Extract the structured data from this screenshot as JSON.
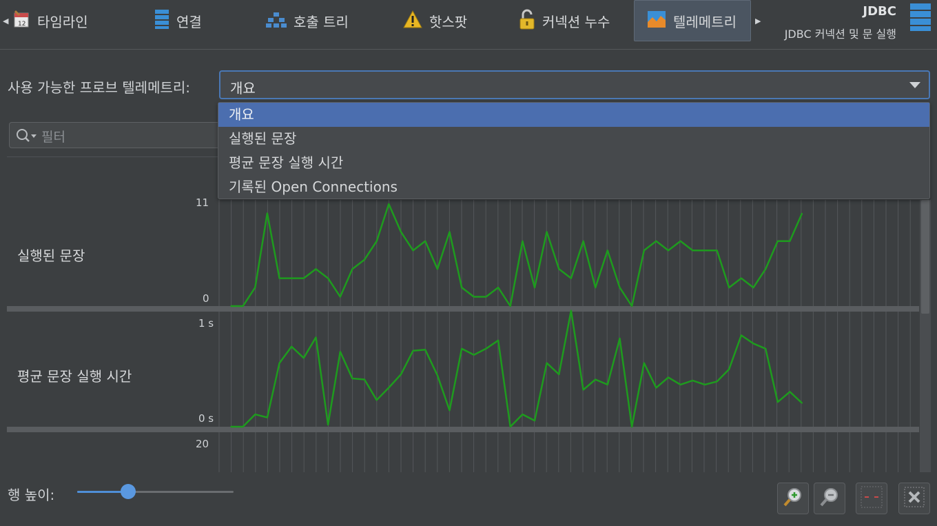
{
  "tabs": [
    {
      "label": "타임라인",
      "icon": "calendar-icon"
    },
    {
      "label": "연결",
      "icon": "database-stack-icon"
    },
    {
      "label": "호출 트리",
      "icon": "call-tree-icon"
    },
    {
      "label": "핫스팟",
      "icon": "warning-icon"
    },
    {
      "label": "커넥션 누수",
      "icon": "padlock-icon"
    },
    {
      "label": "텔레메트리",
      "icon": "telemetry-icon",
      "active": true
    }
  ],
  "probe": {
    "title": "JDBC",
    "subtitle": "JDBC 커넥션 및 문 실행"
  },
  "telemetry_select": {
    "label": "사용 가능한 프로브 텔레메트리:",
    "value": "개요",
    "options": [
      "개요",
      "실행된 문장",
      "평균 문장 실행 시간",
      "기록된 Open Connections"
    ],
    "selected_index": 0
  },
  "filter": {
    "placeholder": "필터"
  },
  "rows": [
    {
      "label": "실행된 문장",
      "axis_max": "11",
      "axis_min": "0"
    },
    {
      "label": "평균 문장 실행 시간",
      "axis_max": "1 s",
      "axis_min": "0 s"
    },
    {
      "label": "",
      "axis_max": "20",
      "axis_min": ""
    }
  ],
  "row_height": {
    "label": "행 높이:",
    "value": 0.33
  },
  "colors": {
    "series": "#1e9b1e",
    "accent": "#4b6eaf",
    "background": "#3c3f41"
  },
  "chart_data": [
    {
      "type": "line",
      "title": "실행된 문장",
      "ylim": [
        0,
        11
      ],
      "series": [
        {
          "values": [
            0,
            0,
            2,
            10,
            3,
            3,
            3,
            4,
            3,
            1,
            4,
            5,
            7,
            11,
            8,
            6,
            7,
            4,
            8,
            2,
            1,
            1,
            2,
            0,
            7,
            2,
            8,
            4,
            3,
            7,
            2,
            6,
            2,
            0,
            6,
            7,
            6,
            7,
            6,
            6,
            6,
            2,
            3,
            2,
            4,
            7,
            7,
            10
          ]
        }
      ]
    },
    {
      "type": "line",
      "title": "평균 문장 실행 시간",
      "ylim": [
        0,
        1
      ],
      "series": [
        {
          "values": [
            0,
            0,
            0.12,
            0.09,
            0.62,
            0.78,
            0.67,
            0.87,
            0.02,
            0.73,
            0.47,
            0.46,
            0.26,
            0.38,
            0.51,
            0.74,
            0.75,
            0.5,
            0.16,
            0.76,
            0.7,
            0.76,
            0.84,
            0,
            0.12,
            0.06,
            0.62,
            0.51,
            1.13,
            0.36,
            0.46,
            0.41,
            0.86,
            0,
            0.62,
            0.38,
            0.48,
            0.41,
            0.45,
            0.41,
            0.44,
            0.56,
            0.89,
            0.81,
            0.76,
            0.24,
            0.34,
            0.23
          ]
        }
      ]
    }
  ]
}
